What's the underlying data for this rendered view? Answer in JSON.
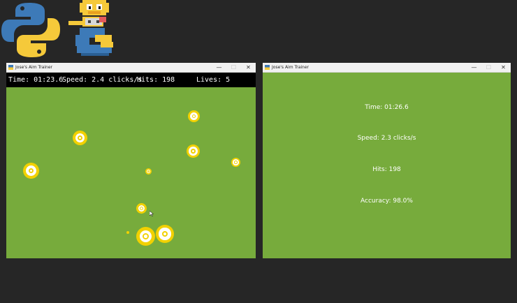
{
  "logos": {
    "python": "python-logo",
    "pixel": "pixel-python-mascot"
  },
  "trainer_window": {
    "title": "Jose's Aim Trainer",
    "controls": {
      "minimize": "—",
      "maximize": "☐",
      "close": "✕"
    },
    "hud": {
      "time": "Time: 01:23.6",
      "speed": "Speed: 2.4 clicks/s",
      "hits": "Hits: 198",
      "lives": "Lives: 5"
    },
    "background_color": "#77ab3c",
    "target_color": "#f2d100"
  },
  "results_window": {
    "title": "Jose's Aim Trainer",
    "controls": {
      "minimize": "—",
      "maximize": "☐",
      "close": "✕"
    },
    "time": "Time: 01:26.6",
    "speed": "Speed: 2.3 clicks/s",
    "hits": "Hits: 198",
    "accuracy": "Accuracy: 98.0%"
  }
}
